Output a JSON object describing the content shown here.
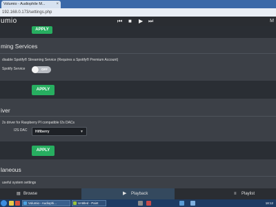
{
  "browser": {
    "tab_title": "Volumio - Audiophile M...",
    "tab_close": "×",
    "address": "192.168.0.173/settings.php"
  },
  "app": {
    "logo": "umio",
    "menu_partial": "M"
  },
  "sections": {
    "top_apply": "APPLY",
    "spotify": {
      "title": "ming Services",
      "description": "disable Spotify® Streaming Service (Requires a Spotify® Premium Account)",
      "label": "Spotify Service",
      "toggle_text": "OFF",
      "apply": "APPLY"
    },
    "driver": {
      "title": "iver",
      "description": "2s driver for Raspberry PI compatible I2s DACs",
      "label": "I2S DAC",
      "selected": "Hifiberry",
      "apply": "APPLY"
    },
    "misc": {
      "title": "laneous",
      "description": "useful system settings"
    }
  },
  "bottom_nav": {
    "browse": "Browse",
    "playback": "Playback",
    "playlist": "Playlist"
  },
  "taskbar": {
    "task1": "Volumio - Audiophi...",
    "task2": "Untitled - Paint",
    "clock": "18:12"
  },
  "colors": {
    "accent": "#27ae60",
    "playback_bg": "#34495e"
  }
}
